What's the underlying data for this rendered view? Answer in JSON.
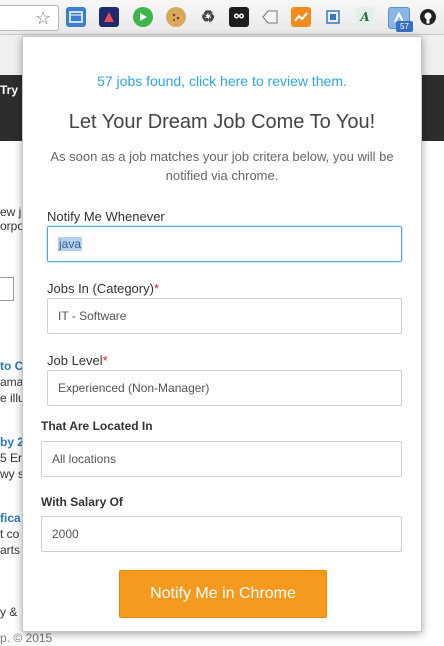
{
  "popup": {
    "notice": "57 jobs found, click here to review them.",
    "heading": "Let Your Dream Job Come To You!",
    "subtext": "As soon as a job matches your job critera below, you will be notified via chrome.",
    "fields": {
      "keyword": {
        "label": "Notify Me Whenever",
        "value": "java"
      },
      "category": {
        "label": "Jobs In (Category)",
        "required_mark": "*",
        "value": "IT - Software"
      },
      "level": {
        "label": "Job Level",
        "required_mark": "*",
        "value": "Experienced (Non-Manager)"
      },
      "location": {
        "label": "That Are Located In",
        "value": "All locations"
      },
      "salary": {
        "label": "With Salary Of",
        "value": "2000"
      }
    },
    "submit_label": "Notify Me in Chrome"
  },
  "toolbar": {
    "star_icon": "☆",
    "extensions": [
      "window-icon",
      "media-icon",
      "play-icon",
      "cookie-icon",
      "recycle-icon",
      "owl-icon",
      "tag-icon",
      "chart-icon",
      "fullscreen-icon",
      "font-icon",
      "jobs-extension-icon",
      "github-icon"
    ],
    "badge_count": "57"
  },
  "background_page": {
    "try_text": "Try",
    "snippet_1a": "ew j",
    "snippet_1b": "orpo",
    "snippet_2a": "to C",
    "snippet_2b": "ama",
    "snippet_2c": "e illu",
    "snippet_3a": "by 2",
    "snippet_3b": "5 Er",
    "snippet_3c": "wy sp",
    "snippet_4a": "fica",
    "snippet_4b": "t co",
    "snippet_4c": "arts",
    "footer_1": "y &",
    "footer_2": "p. © 2015"
  },
  "colors": {
    "link": "#29a8e0",
    "button": "#f59a1f",
    "required": "#d9242c",
    "focus_border": "#5aa6d8"
  }
}
